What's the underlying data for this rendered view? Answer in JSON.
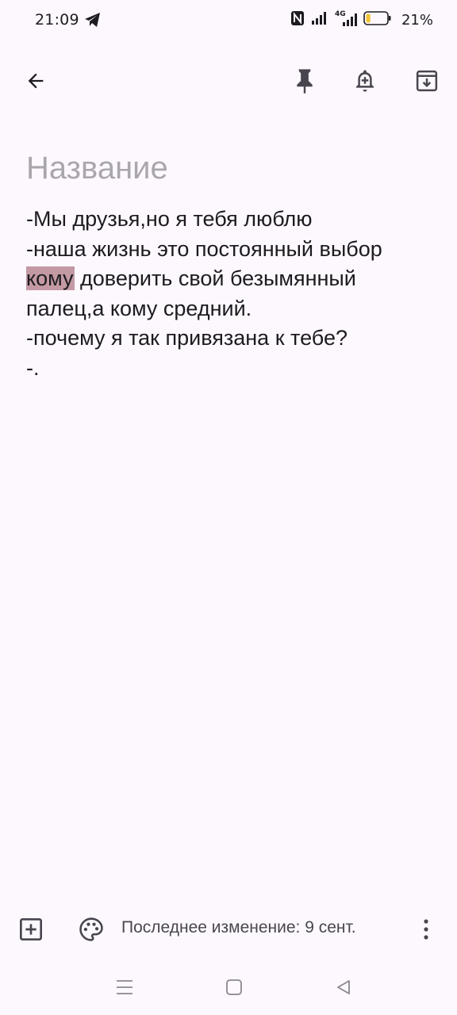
{
  "status_bar": {
    "time": "21:09",
    "battery_percent": "21%",
    "battery_level": 0.21,
    "network_label": "4G",
    "icons": [
      "telegram-icon",
      "nfc-icon",
      "signal-icon",
      "signal-4g-icon",
      "battery-icon"
    ]
  },
  "toolbar": {
    "icons": [
      "back-arrow-icon",
      "pin-icon",
      "add-reminder-icon",
      "archive-icon"
    ]
  },
  "note": {
    "title_placeholder": "Название",
    "lines": [
      "-Мы друзья,но я тебя люблю",
      "-наша жизнь это постоянный выбор",
      "доверить свой безымянный",
      "палец,а кому средний.",
      "-почему я так привязана к тебе?",
      "-."
    ],
    "selected_word": "кому"
  },
  "bottom_bar": {
    "edited_text": "Последнее изменение: 9 сент.",
    "icons": [
      "add-box-icon",
      "palette-icon",
      "more-vert-icon"
    ]
  },
  "navigation_bar": {
    "icons": [
      "recents-menu-icon",
      "home-square-icon",
      "back-triangle-icon"
    ]
  },
  "colors": {
    "background": "#fdf8fd",
    "text": "#1d1b20",
    "placeholder": "#aaa6ad",
    "selection": "#c39aa4",
    "icon": "#49454f",
    "battery_low": "#f2c335"
  }
}
